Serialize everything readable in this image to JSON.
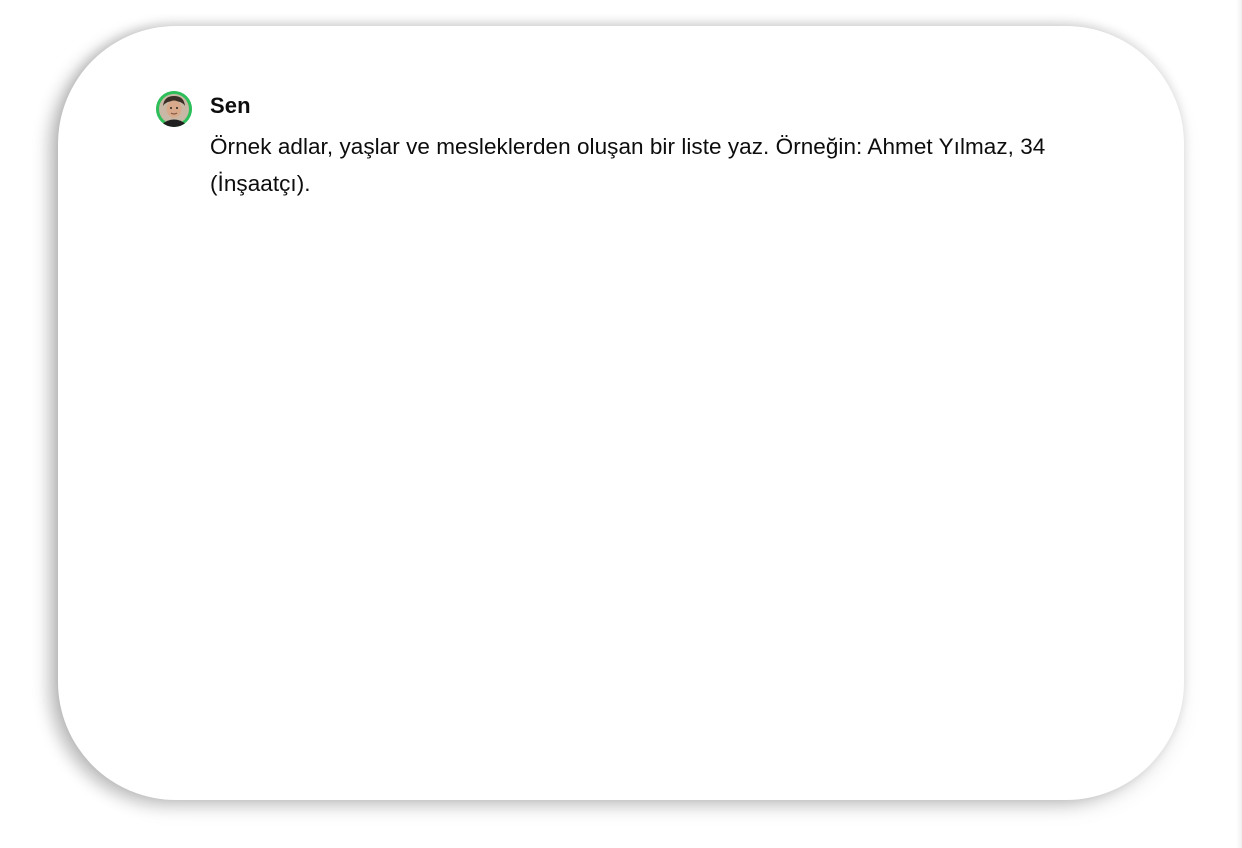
{
  "message": {
    "author": "Sen",
    "avatar_icon": "user-avatar-photo",
    "text": "Örnek adlar, yaşlar ve mesleklerden oluşan bir liste yaz. Örneğin: Ahmet Yılmaz, 34 (İnşaatçı)."
  },
  "colors": {
    "avatar_ring": "#2fbf5a",
    "text": "#0d0d0d",
    "background": "#ffffff"
  }
}
